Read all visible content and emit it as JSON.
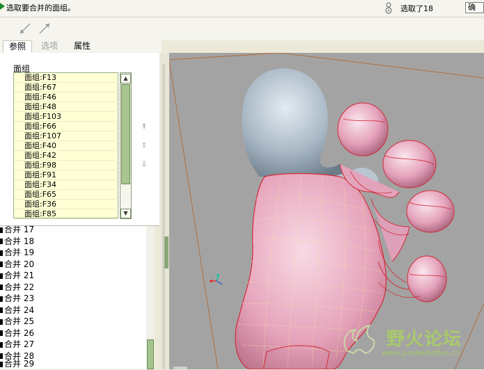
{
  "dashboard": {
    "prompt": "选取要合并的面组。",
    "selection_status": "选取了18",
    "ok_label": "确"
  },
  "tabs": [
    {
      "label": "参照",
      "active": true
    },
    {
      "label": "选项",
      "active": false
    },
    {
      "label": "属性",
      "active": false
    }
  ],
  "quilts": {
    "label": "面组",
    "items": [
      "面组:F13",
      "面组:F67",
      "面组:F46",
      "面组:F48",
      "面组:F103",
      "面组:F66",
      "面组:F107",
      "面组:F40",
      "面组:F42",
      "面组:F98",
      "面组:F91",
      "面组:F34",
      "面组:F65",
      "面组:F36",
      "面组:F85"
    ]
  },
  "model_tree": {
    "rows": [
      "合并 17",
      "合并 18",
      "合并 19",
      "合并 20",
      "合并 21",
      "合并 22",
      "合并 23",
      "合并 24",
      "合并 25",
      "合并 26",
      "合并 27",
      "合并 28",
      "合并 29"
    ]
  },
  "watermark": {
    "name": "野火论坛",
    "url": "www.proewildfire.cn"
  },
  "colors": {
    "list_bg": "#ffffd5",
    "surface_pink": "#e8a8bf",
    "surface_grey": "#a9b7c3",
    "viewport_bg": "#a3a3a3"
  }
}
